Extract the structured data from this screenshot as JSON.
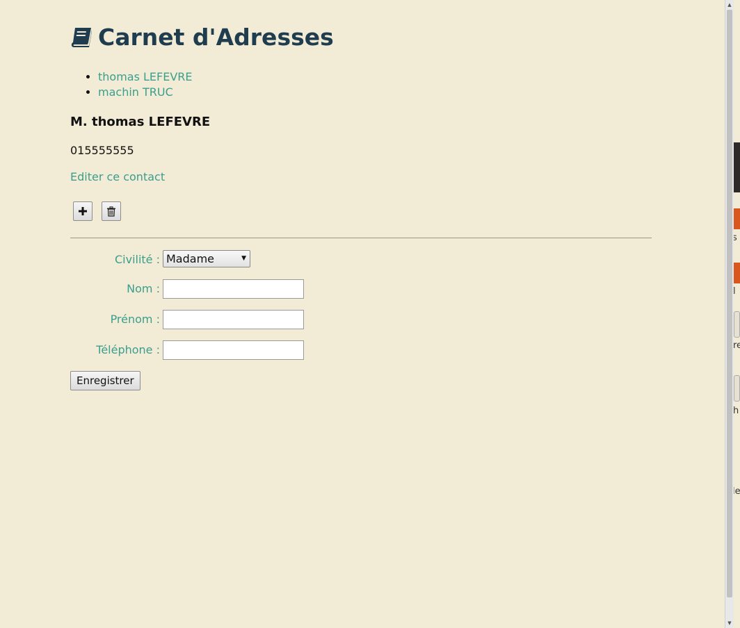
{
  "page": {
    "title": "Carnet d'Adresses",
    "title_icon": "book-icon"
  },
  "contacts": [
    {
      "label": "thomas LEFEVRE"
    },
    {
      "label": "machin TRUC"
    }
  ],
  "selected_contact": {
    "full_name": "M. thomas LEFEVRE",
    "phone": "015555555",
    "edit_label": "Editer ce contact"
  },
  "actions": {
    "add_icon": "plus-icon",
    "delete_icon": "trash-icon"
  },
  "form": {
    "civility_label": "Civilité :",
    "civility_value": "Madame",
    "last_name_label": "Nom :",
    "last_name_value": "",
    "first_name_label": "Prénom :",
    "first_name_value": "",
    "phone_label": "Téléphone :",
    "phone_value": "",
    "submit_label": "Enregistrer"
  },
  "colors": {
    "background": "#f2ecd6",
    "title": "#1f3d4e",
    "accent": "#3a9e8c"
  },
  "background_window_fragments": [
    "s",
    "l",
    "re",
    "h",
    "le"
  ]
}
